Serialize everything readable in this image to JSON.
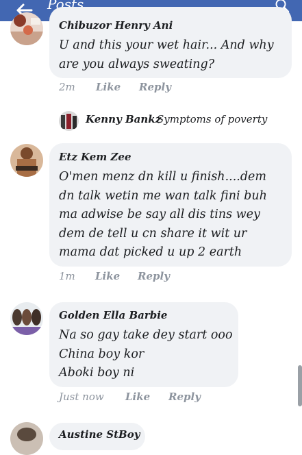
{
  "header": {
    "title": "Posts",
    "back_icon": "back-arrow-icon",
    "search_icon": "search-icon",
    "color": "#4267b2"
  },
  "comments": [
    {
      "author": "Chibuzor Henry Ani",
      "lines": [
        "U and this your wet hair... And why",
        "are you always sweating?"
      ],
      "time": "2m",
      "like": "Like",
      "reply": "Reply"
    },
    {
      "author": "Etz Kem Zee",
      "lines": [
        "O'men menz dn kill u finish....dem",
        "dn talk wetin me wan talk fini buh",
        "ma adwise be say all dis tins wey",
        "dem de tell u cn share it wit ur",
        "mama dat picked u up 2 earth"
      ],
      "time": "1m",
      "like": "Like",
      "reply": "Reply"
    },
    {
      "author": "Golden Ella Barbie",
      "lines": [
        "Na so gay take dey start ooo",
        "China boy kor",
        "Aboki boy ni"
      ],
      "time": "Just now",
      "like": "Like",
      "reply": "Reply"
    },
    {
      "author": "Austine StBoy"
    }
  ],
  "reply_preview": {
    "name": "Kenny Bankz",
    "text": "Symptoms of poverty"
  },
  "colors": {
    "bubble": "#f0f2f5",
    "meta": "#8d949e",
    "text": "#1c1e21"
  }
}
